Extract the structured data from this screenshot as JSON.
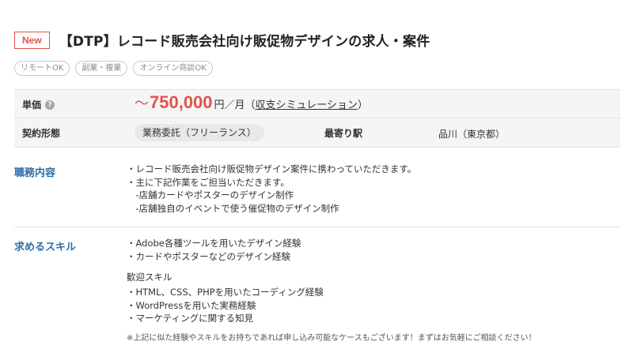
{
  "header": {
    "badge": "New",
    "title": "【DTP】レコード販売会社向け販促物デザインの求人・案件"
  },
  "tags": [
    "リモートOK",
    "副業・複業",
    "オンライン商談OK"
  ],
  "details": {
    "unit_price_label": "単価",
    "help_icon": "?",
    "price_prefix": "～",
    "price_value": "750,000",
    "price_unit": "円／月（",
    "simulation_link": "収支シミュレーション",
    "price_suffix": "）",
    "contract_label": "契約形態",
    "contract_value": "業務委託（フリーランス）",
    "station_label": "最寄り駅",
    "station_value": "品川（東京都）"
  },
  "duties": {
    "title": "職務内容",
    "lines": [
      "・レコード販売会社向け販促物デザイン案件に携わっていただきます。",
      "・主に下記作業をご担当いただきます。",
      "　-店舗カードやポスターのデザイン制作",
      "　-店舗独自のイベントで使う催促物のデザイン制作"
    ]
  },
  "skills": {
    "title": "求めるスキル",
    "required_lines": [
      "・Adobe各種ツールを用いたデザイン経験",
      "・カードやポスターなどのデザイン経験"
    ],
    "welcome_title": "歓迎スキル",
    "welcome_lines": [
      "・HTML、CSS、PHPを用いたコーディング経験",
      "・WordPressを用いた実務経験",
      "・マーケティングに関する知見"
    ],
    "note": "※上記に似た経験やスキルをお持ちであれば申し込み可能なケースもございます！まずはお気軽にご相談ください！"
  }
}
